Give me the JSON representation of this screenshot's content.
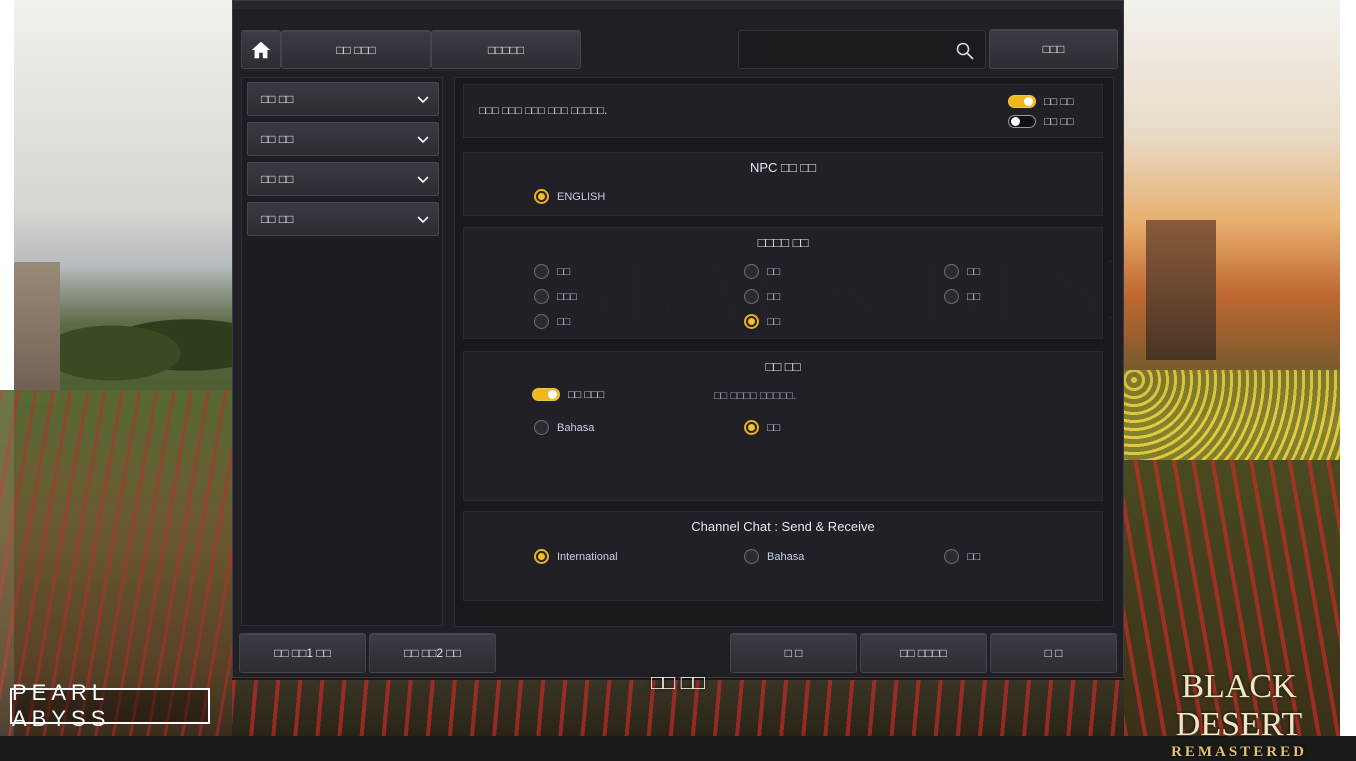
{
  "window": {
    "nav_buttons": [
      "□□ □□□",
      "□□□□□"
    ],
    "search": {
      "value": "",
      "placeholder": ""
    },
    "reset_label": "□□□",
    "sidebar": {
      "items": [
        {
          "label": "□□ □□"
        },
        {
          "label": "□□ □□"
        },
        {
          "label": "□□ □□"
        },
        {
          "label": "□□ □□"
        }
      ]
    },
    "notice": {
      "text": "□□□ □□□ □□□ □□□ □□□□□.",
      "toggles": [
        {
          "label": "□□ □□",
          "state": "on"
        },
        {
          "label": "□□ □□",
          "state": "off"
        }
      ]
    },
    "npc_voice": {
      "title": "NPC □□ □□",
      "options": [
        {
          "label": "ENGLISH",
          "checked": true
        }
      ]
    },
    "language_section": {
      "title": "□□□□ □□",
      "options": [
        {
          "label": "□□",
          "checked": false
        },
        {
          "label": "□□",
          "checked": false
        },
        {
          "label": "□□",
          "checked": false
        },
        {
          "label": "□□□",
          "checked": false
        },
        {
          "label": "□□",
          "checked": false
        },
        {
          "label": "□□",
          "checked": false
        },
        {
          "label": "□□",
          "checked": false
        },
        {
          "label": "□□",
          "checked": true
        }
      ]
    },
    "text_section": {
      "title": "□□ □□",
      "toggle_label": "□□ □□□",
      "toggle_state": "on",
      "hint": "□□ □□□□ □□□□□.",
      "options": [
        {
          "label": "Bahasa",
          "checked": false
        },
        {
          "label": "□□",
          "checked": true
        }
      ]
    },
    "channel_chat": {
      "title": "Channel Chat : Send & Receive",
      "options": [
        {
          "label": "International",
          "checked": true
        },
        {
          "label": "Bahasa",
          "checked": false
        },
        {
          "label": "□□",
          "checked": false
        }
      ]
    },
    "bottom_buttons": [
      "□□ □□1 □□",
      "□□ □□2 □□",
      "□ □",
      "□□ □□□□",
      "□ □"
    ]
  },
  "overlay_text": "□□ □□",
  "brand": {
    "left_logo": "PEARL ABYSS",
    "right_logo_main": "BLACK DESERT",
    "right_logo_sub": "REMASTERED"
  },
  "colors": {
    "accent": "#f0b820",
    "panel_bg": "#1f1f25",
    "button_bg": "#34343c"
  }
}
